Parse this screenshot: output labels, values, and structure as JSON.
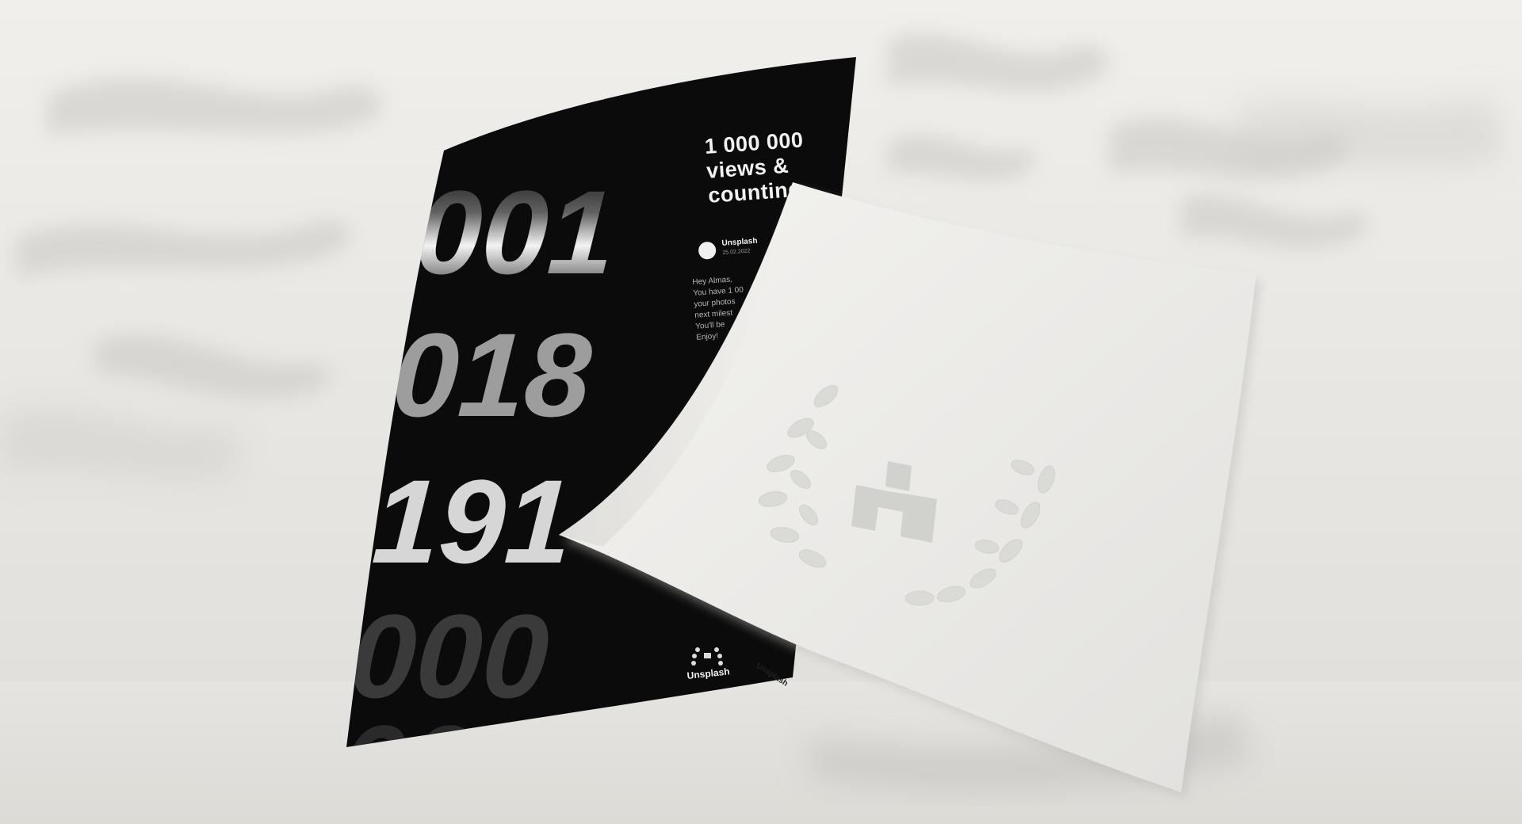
{
  "poster": {
    "headline": [
      "1 000 000",
      "views &",
      "counting"
    ],
    "profile_name": "Unsplash",
    "profile_date": "25.02.2022",
    "message": [
      "Hey Almas,",
      "You have 1 00",
      "your photos",
      "next milest",
      "You'll be",
      "Enjoy!"
    ],
    "digit_rows": [
      "001",
      "018",
      "191",
      "000"
    ],
    "footer_brand": "Unsplash"
  },
  "white_sheet": {
    "brand": "Unsplash"
  },
  "colors": {
    "wall": "#ecebe7",
    "poster_black": "#0b0b0b",
    "paper_white": "#ecebe8"
  }
}
